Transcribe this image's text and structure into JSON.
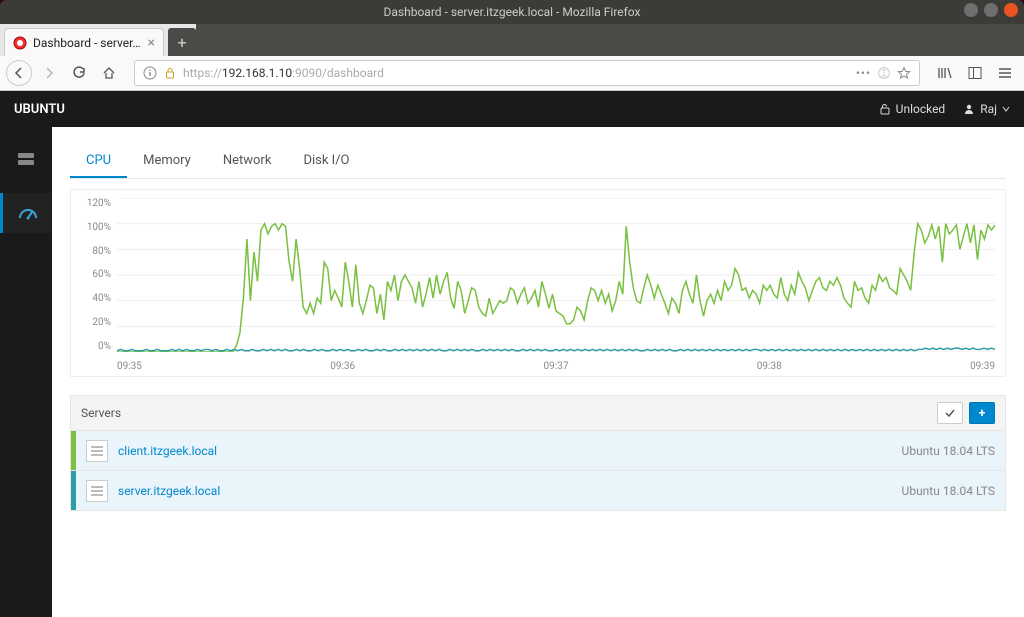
{
  "window": {
    "title": "Dashboard - server.itzgeek.local - Mozilla Firefox"
  },
  "browser": {
    "tab_label": "Dashboard - server.itzge",
    "url_prefix": "https://",
    "url_host": "192.168.1.10",
    "url_path": ":9090/dashboard"
  },
  "header": {
    "brand": "UBUNTU",
    "lock_label": "Unlocked",
    "user_label": "Raj"
  },
  "tabs": [
    "CPU",
    "Memory",
    "Network",
    "Disk I/O"
  ],
  "servers_header": "Servers",
  "servers": [
    {
      "name": "client.itzgeek.local",
      "os": "Ubuntu 18.04 LTS",
      "color": "green"
    },
    {
      "name": "server.itzgeek.local",
      "os": "Ubuntu 18.04 LTS",
      "color": "teal"
    }
  ],
  "chart_data": {
    "type": "line",
    "title": "",
    "xlabel": "",
    "ylabel": "",
    "ylim": [
      0,
      120
    ],
    "y_ticks": [
      "120%",
      "100%",
      "80%",
      "60%",
      "40%",
      "20%",
      "0%"
    ],
    "x_ticks": [
      "09:35",
      "09:36",
      "09:37",
      "09:38",
      "09:39"
    ],
    "series": [
      {
        "name": "client.itzgeek.local",
        "color": "#7ac143",
        "values": [
          0,
          0,
          0,
          0,
          0,
          0,
          0,
          0,
          0,
          0,
          0,
          0,
          0,
          0,
          0,
          0,
          0,
          0,
          0,
          0,
          0,
          0,
          0,
          0,
          0,
          0,
          0,
          0,
          0,
          0,
          0,
          0,
          0,
          0,
          5,
          15,
          42,
          88,
          40,
          78,
          55,
          95,
          100,
          92,
          98,
          100,
          95,
          100,
          98,
          70,
          55,
          88,
          65,
          35,
          30,
          38,
          30,
          42,
          38,
          70,
          65,
          40,
          48,
          42,
          35,
          70,
          55,
          35,
          68,
          38,
          30,
          40,
          52,
          50,
          30,
          45,
          25,
          55,
          48,
          60,
          40,
          55,
          60,
          55,
          50,
          38,
          55,
          35,
          45,
          58,
          42,
          60,
          45,
          55,
          62,
          42,
          34,
          55,
          48,
          30,
          40,
          50,
          48,
          35,
          30,
          28,
          42,
          30,
          35,
          40,
          38,
          40,
          50,
          48,
          38,
          45,
          50,
          38,
          42,
          48,
          35,
          55,
          45,
          34,
          45,
          32,
          30,
          28,
          22,
          22,
          25,
          35,
          32,
          25,
          40,
          50,
          48,
          40,
          48,
          38,
          45,
          32,
          40,
          55,
          45,
          98,
          70,
          50,
          40,
          38,
          50,
          60,
          52,
          42,
          52,
          45,
          38,
          30,
          42,
          38,
          30,
          48,
          55,
          45,
          38,
          60,
          40,
          28,
          40,
          45,
          38,
          48,
          40,
          55,
          48,
          52,
          65,
          60,
          48,
          50,
          42,
          48,
          45,
          38,
          52,
          48,
          52,
          45,
          42,
          58,
          45,
          40,
          52,
          45,
          62,
          55,
          50,
          40,
          48,
          55,
          58,
          50,
          48,
          55,
          52,
          58,
          52,
          42,
          38,
          35,
          55,
          48,
          50,
          42,
          38,
          52,
          48,
          60,
          55,
          58,
          50,
          48,
          45,
          65,
          60,
          55,
          48,
          78,
          100,
          95,
          85,
          90,
          99,
          88,
          98,
          70,
          100,
          92,
          95,
          99,
          80,
          90,
          100,
          85,
          99,
          72,
          95,
          88,
          99,
          95,
          99
        ]
      },
      {
        "name": "server.itzgeek.local",
        "color": "#2d9ea3",
        "values": [
          1,
          2,
          1,
          1,
          2,
          1,
          1,
          1,
          2,
          1,
          1,
          2,
          1,
          1,
          1,
          2,
          1,
          2,
          1,
          2,
          1,
          1,
          2,
          1,
          2,
          2,
          1,
          2,
          1,
          1,
          2,
          1,
          2,
          1,
          2,
          1,
          1,
          2,
          1,
          1,
          2,
          1,
          2,
          1,
          2,
          1,
          2,
          1,
          1,
          2,
          1,
          2,
          1,
          1,
          2,
          1,
          2,
          1,
          1,
          2,
          1,
          2,
          1,
          2,
          1,
          1,
          2,
          1,
          2,
          1,
          1,
          2,
          1,
          2,
          1,
          1,
          2,
          1,
          2,
          1,
          2,
          1,
          2,
          1,
          2,
          1,
          2,
          1,
          2,
          1,
          1,
          2,
          1,
          2,
          1,
          2,
          1,
          2,
          1,
          1,
          2,
          1,
          2,
          1,
          2,
          1,
          2,
          1,
          2,
          1,
          1,
          2,
          1,
          2,
          1,
          2,
          1,
          2,
          1,
          1,
          2,
          1,
          2,
          1,
          2,
          1,
          2,
          1,
          2,
          1,
          2,
          1,
          2,
          1,
          2,
          1,
          2,
          1,
          2,
          1,
          2,
          1,
          2,
          1,
          1,
          2,
          1,
          2,
          1,
          2,
          1,
          2,
          1,
          1,
          2,
          1,
          2,
          1,
          2,
          1,
          2,
          1,
          2,
          1,
          2,
          1,
          2,
          1,
          2,
          1,
          2,
          1,
          2,
          1,
          2,
          2,
          1,
          2,
          1,
          2,
          1,
          2,
          1,
          2,
          1,
          2,
          1,
          2,
          1,
          2,
          1,
          2,
          1,
          2,
          1,
          2,
          1,
          2,
          1,
          2,
          1,
          2,
          1,
          2,
          1,
          2,
          1,
          2,
          1,
          2,
          1,
          2,
          1,
          2,
          1,
          2,
          1,
          2,
          1,
          2,
          2,
          3,
          2,
          3,
          2,
          3,
          2,
          3,
          2,
          3,
          3,
          2,
          3,
          2,
          3,
          2,
          2,
          3,
          2,
          3,
          2
        ]
      }
    ]
  }
}
